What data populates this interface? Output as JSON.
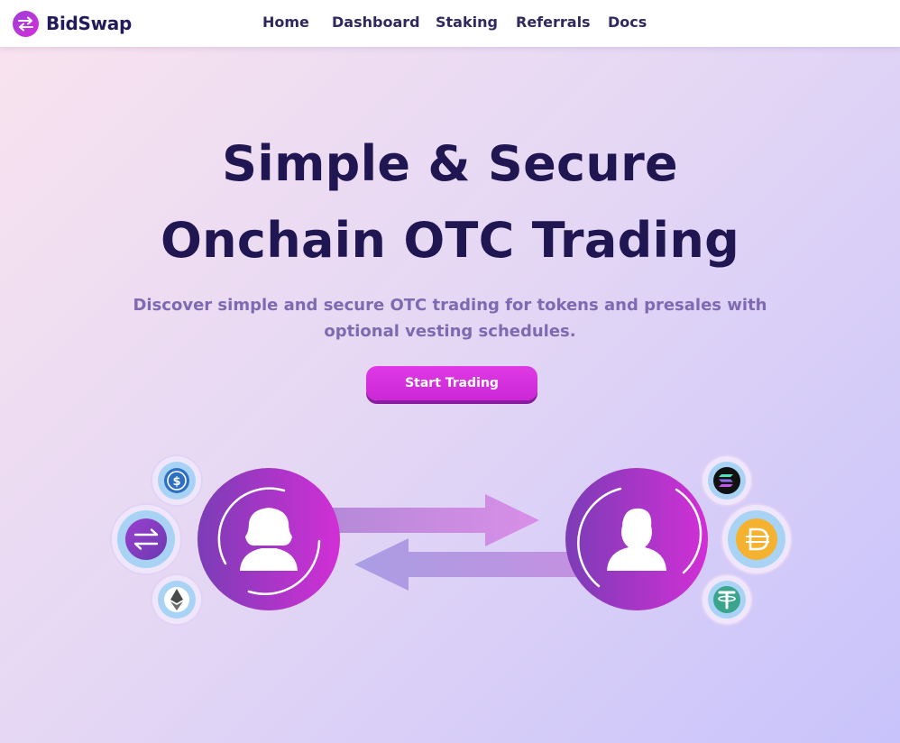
{
  "nav": {
    "brand": "BidSwap",
    "links": [
      "Home",
      "Dashboard",
      "Staking",
      "Referrals",
      "Docs"
    ]
  },
  "hero": {
    "title_line1": "Simple & Secure",
    "title_line2": "Onchain OTC Trading",
    "subtitle_line1": "Discover simple and secure OTC trading for tokens and presales with",
    "subtitle_line2": "optional vesting schedules.",
    "cta_label": "Start Trading"
  },
  "illustration": {
    "left_tokens": [
      "usdc-icon",
      "swap-icon",
      "ethereum-icon"
    ],
    "right_tokens": [
      "solana-icon",
      "dai-icon",
      "tether-icon"
    ]
  },
  "colors": {
    "brand_dark": "#231a5c",
    "accent": "#d62fd9",
    "subtitle": "#7e6ab0"
  }
}
